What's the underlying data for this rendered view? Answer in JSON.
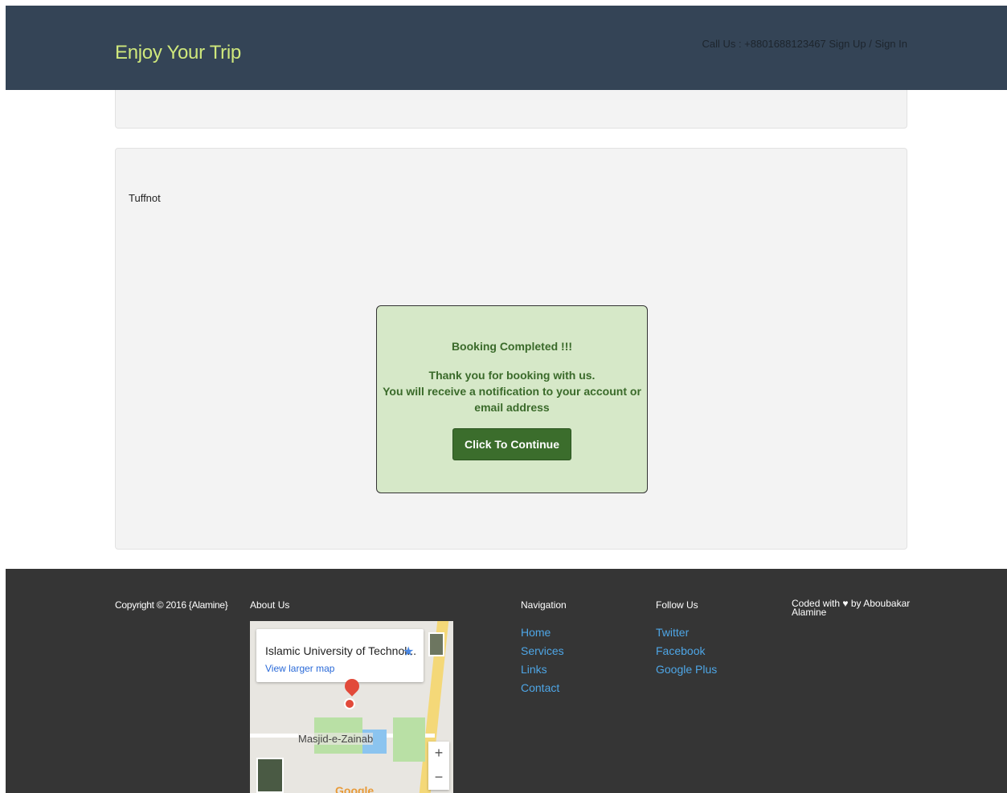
{
  "header": {
    "brand": "Enjoy Your Trip",
    "call_label": "Call Us : +8801688123467",
    "signup": "Sign Up",
    "separator": "/",
    "signin": "Sign In"
  },
  "main": {
    "name": "Tuffnot",
    "booking": {
      "title": "Booking Completed !!!",
      "line1": "Thank you for booking with us.",
      "line2": "You will receive a notification to your account or email address",
      "button": "Click To Continue"
    }
  },
  "footer": {
    "copyright": "Copyright © 2016 {Alamine}",
    "about_title": "About Us",
    "map": {
      "place_title": "Islamic University of Technol...",
      "larger_map": "View larger map",
      "place_label": "Masjid-e-Zainab",
      "zoom_in": "+",
      "zoom_out": "−",
      "google": "Google"
    },
    "navigation_title": "Navigation",
    "navigation_links": [
      "Home",
      "Services",
      "Links",
      "Contact"
    ],
    "follow_title": "Follow Us",
    "follow_links": [
      "Twitter",
      "Facebook",
      "Google Plus"
    ],
    "coded_prefix": "Coded with",
    "coded_suffix": "by Aboubakar Alamine"
  },
  "colors": {
    "header_bg": "#344456",
    "brand": "#cfe87c",
    "booking_bg": "#d6e8c8",
    "button_bg": "#3b6d2c",
    "footer_bg": "#353535",
    "link": "#4ea6e6"
  }
}
